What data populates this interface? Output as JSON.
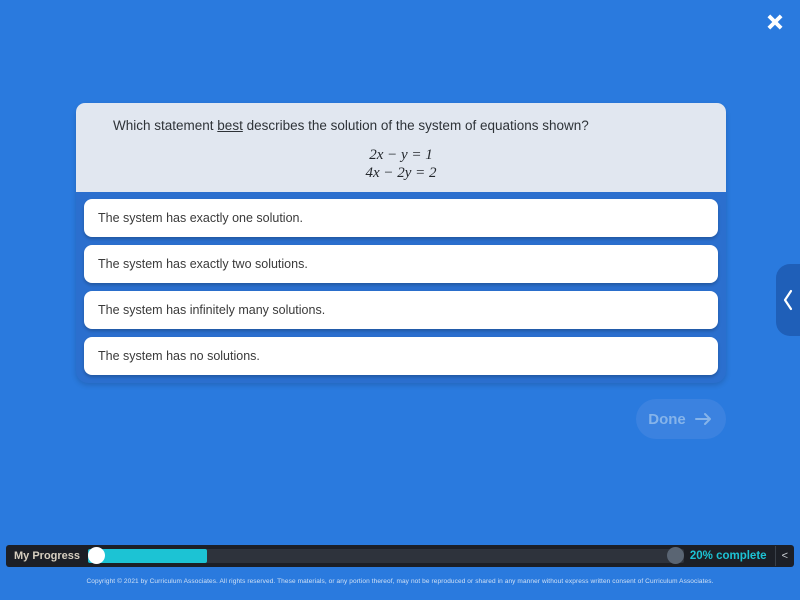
{
  "colors": {
    "background": "#2a7ade",
    "panel": "#2b6fce",
    "question_card": "#e1e7f0",
    "choice_card": "#ffffff",
    "progress_fill": "#1cc3d4",
    "progress_bar_bg": "#1c1f26",
    "drawer_tab": "#1f5fb8",
    "done_button": "#3b82e0"
  },
  "header": {
    "close_icon": "close-icon"
  },
  "drawer": {
    "icon": "chevron-left-icon"
  },
  "question": {
    "prompt_before": "Which statement ",
    "prompt_emphasis": "best",
    "prompt_after": " describes the solution of the system of equations shown?",
    "equations": [
      "2x − y = 1",
      "4x − 2y = 2"
    ]
  },
  "choices": [
    {
      "label": "The system has exactly one solution."
    },
    {
      "label": "The system has exactly two solutions."
    },
    {
      "label": "The system has infinitely many solutions."
    },
    {
      "label": "The system has no solutions."
    }
  ],
  "done": {
    "label": "Done",
    "icon": "arrow-right-icon",
    "enabled": false
  },
  "progress": {
    "label": "My Progress",
    "percent_text": "20% complete",
    "percent_value": 20,
    "collapse_icon": "<"
  },
  "footer": {
    "copyright": "Copyright © 2021 by Curriculum Associates. All rights reserved. These materials, or any portion thereof, may not be reproduced or shared in any manner without express written consent of Curriculum Associates."
  }
}
